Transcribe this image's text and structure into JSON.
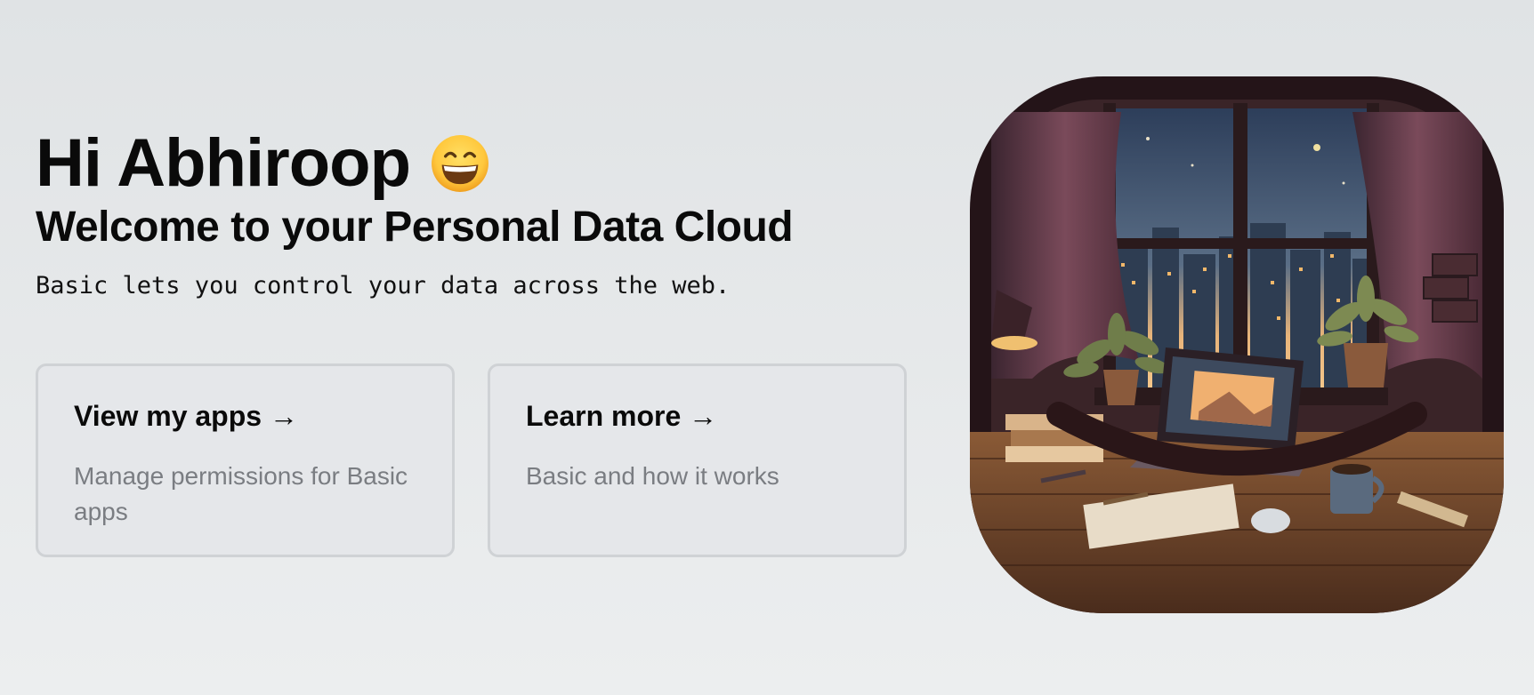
{
  "hero": {
    "greeting": "Hi Abhiroop",
    "emoji_icon": "grinning-face-icon",
    "subtitle": "Welcome to your Personal Data Cloud",
    "tagline": "Basic lets you control your data across the web."
  },
  "cards": [
    {
      "title": "View my apps →",
      "description": "Manage permissions for Basic apps"
    },
    {
      "title": "Learn more →",
      "description": "Basic and how it works"
    }
  ],
  "illustration": {
    "icon": "pixel-art-desk-window-illustration"
  },
  "colors": {
    "background_top": "#e0e3e5",
    "background_bottom": "#eceeef",
    "card_background": "#e5e7ea",
    "card_border": "#cfd2d5",
    "heading": "#0a0a0a",
    "muted_text": "#7a7d82"
  }
}
